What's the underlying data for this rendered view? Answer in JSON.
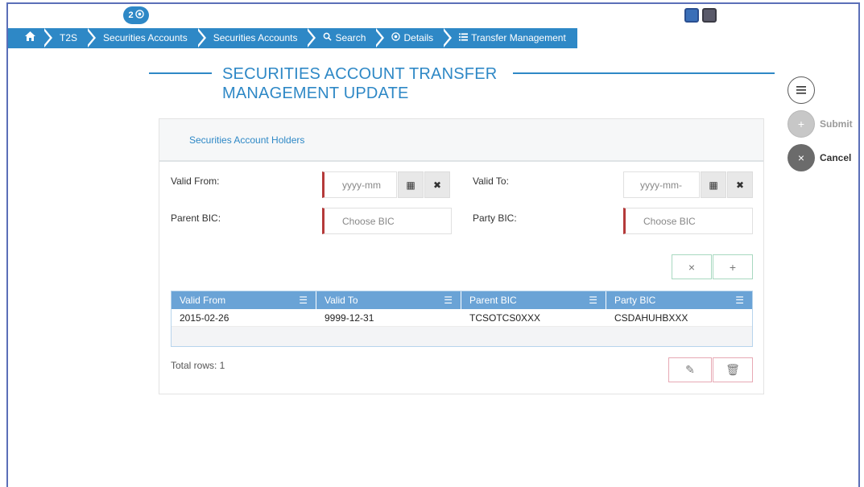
{
  "badge": {
    "count": "2"
  },
  "breadcrumb": [
    {
      "label": ""
    },
    {
      "label": "T2S"
    },
    {
      "label": "Securities Accounts"
    },
    {
      "label": "Securities Accounts"
    },
    {
      "label": "Search"
    },
    {
      "label": "Details"
    },
    {
      "label": "Transfer Management"
    }
  ],
  "title": {
    "line1": "SECURITIES ACCOUNT TRANSFER",
    "line2": "MANAGEMENT UPDATE"
  },
  "actions": {
    "submit_label": "Submit",
    "cancel_label": "Cancel"
  },
  "panel": {
    "heading": "Securities Account Holders"
  },
  "form": {
    "valid_from_label": "Valid From:",
    "valid_from_placeholder": "yyyy-mm",
    "valid_to_label": "Valid To:",
    "valid_to_placeholder": "yyyy-mm-",
    "parent_bic_label": "Parent BIC:",
    "parent_bic_placeholder": "Choose BIC",
    "party_bic_label": "Party BIC:",
    "party_bic_placeholder": "Choose BIC"
  },
  "table": {
    "columns": [
      "Valid From",
      "Valid To",
      "Parent BIC",
      "Party BIC"
    ],
    "rows": [
      [
        "2015-02-26",
        "9999-12-31",
        "TCSOTCS0XXX",
        "CSDAHUHBXXX"
      ]
    ],
    "total": "Total rows: 1"
  },
  "colors": {
    "accent": "#2e88c6",
    "header": "#6aa3d6",
    "required": "#b53a3a"
  }
}
